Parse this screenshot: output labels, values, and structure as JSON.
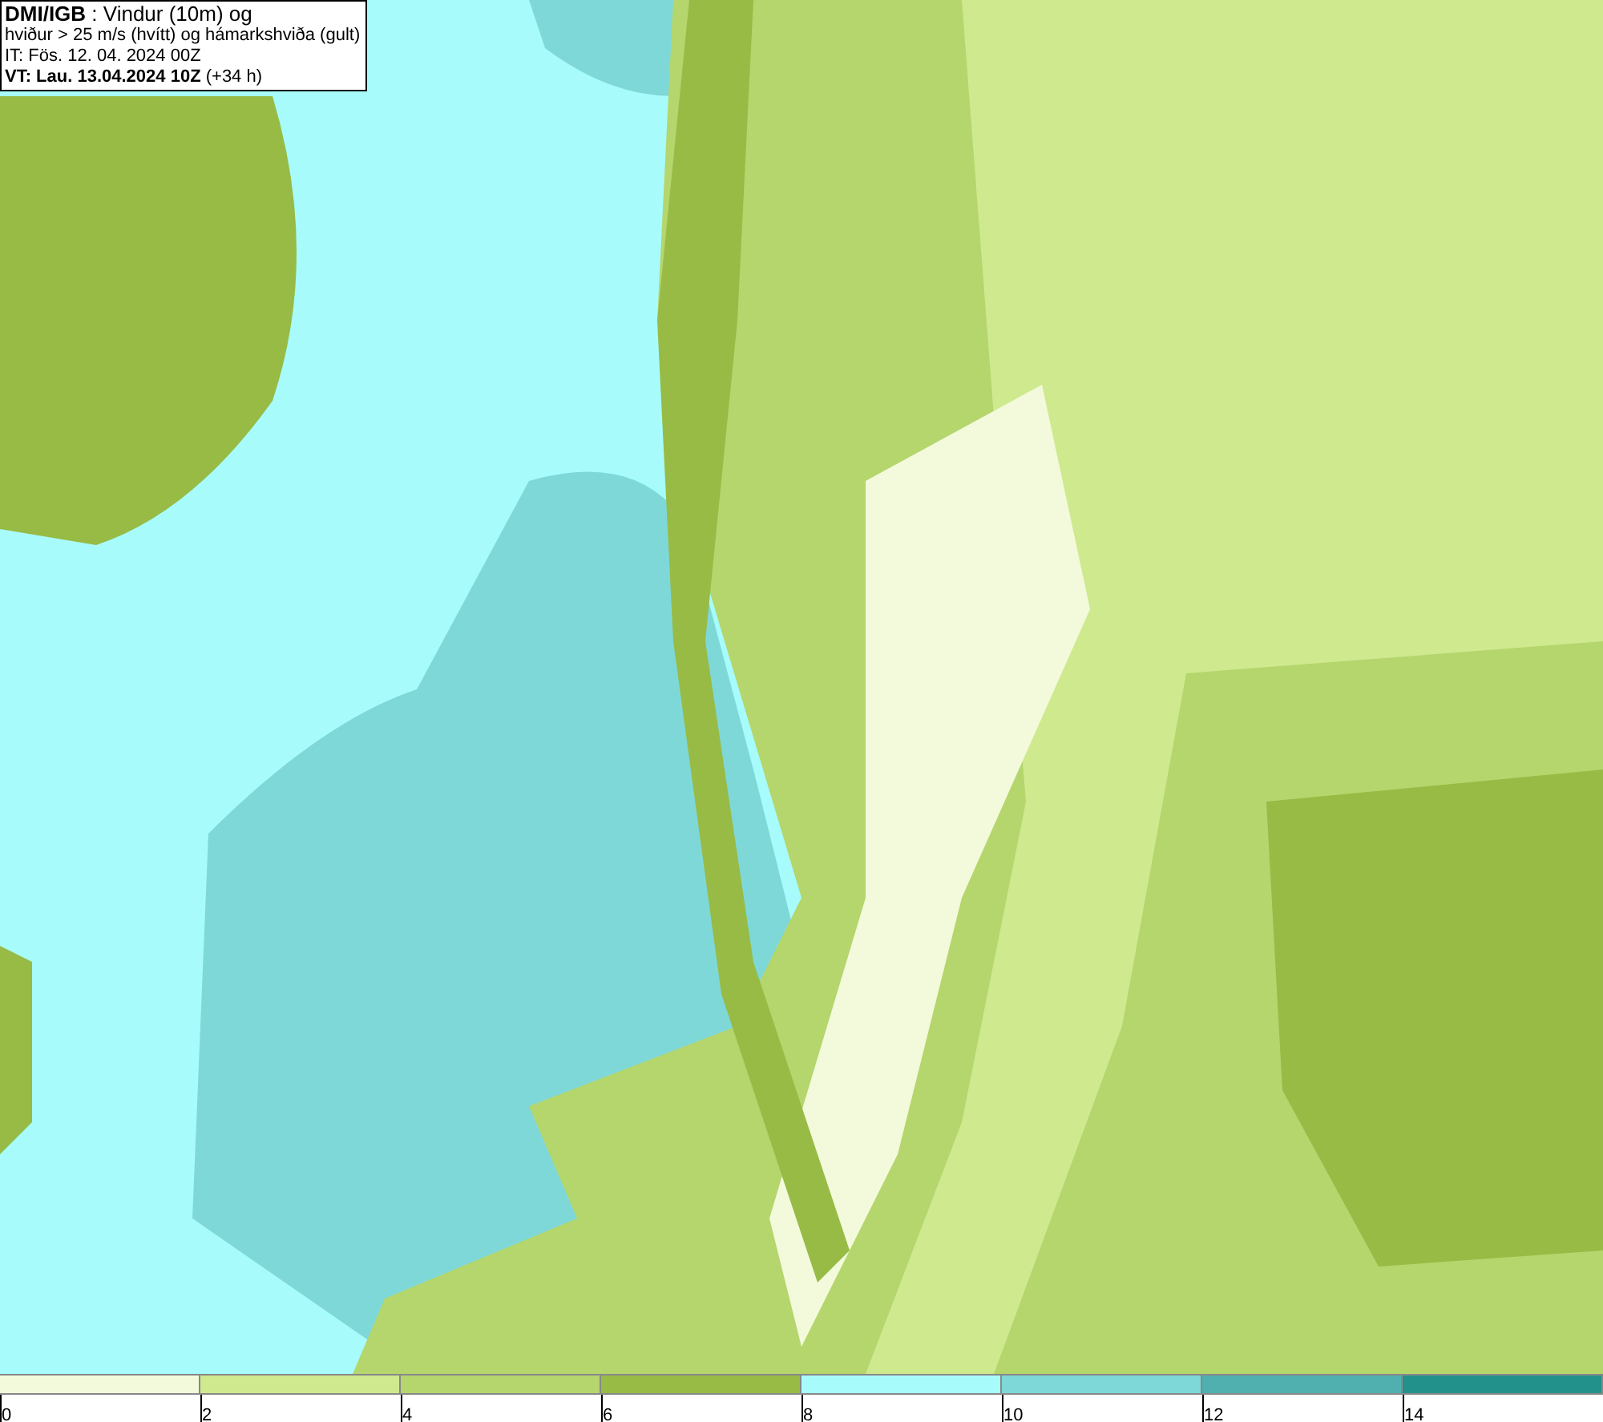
{
  "title_box": {
    "lines": [
      "**DMI/IGB** : Vindur (10m) og",
      "hviður > 25 m/s (hvítt) og hámarkshviða (gult)",
      "IT: Fös. 12. 04. 2024 00Z",
      "**VT: Lau. 13.04.2024 10Z** (+34 h)"
    ]
  },
  "legend": {
    "segments": [
      {
        "color": "#f3fadc",
        "label": "0"
      },
      {
        "color": "#cfe98f",
        "label": "2"
      },
      {
        "color": "#b4d66d",
        "label": "4"
      },
      {
        "color": "#97bb45",
        "label": "6"
      },
      {
        "color": "#a8fbfb",
        "label": "8"
      },
      {
        "color": "#7fd8d8",
        "label": "10"
      },
      {
        "color": "#50b0b0",
        "label": "12"
      },
      {
        "color": "#23918b",
        "label": "14"
      }
    ]
  }
}
